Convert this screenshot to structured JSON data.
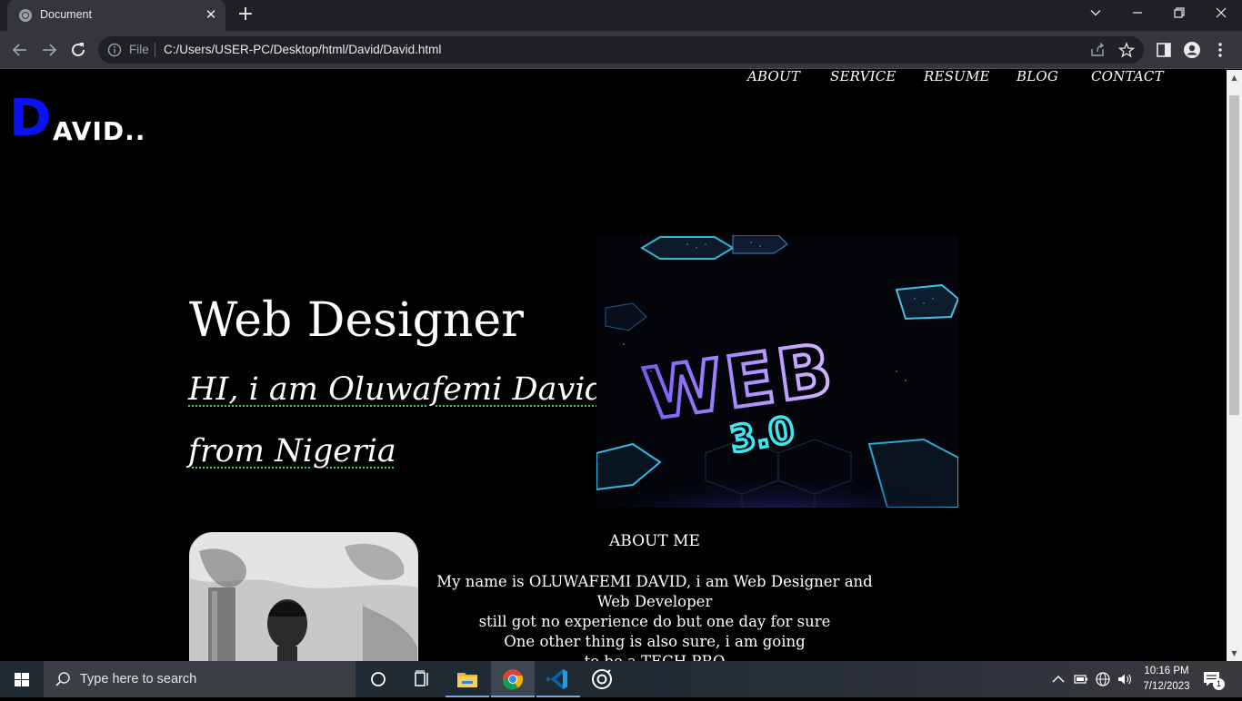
{
  "browser": {
    "tab_title": "Document",
    "tab_close": "✕",
    "new_tab": "+",
    "address_scheme": "File",
    "address_url": "C:/Users/USER-PC/Desktop/html/David/David.html"
  },
  "site": {
    "nav": [
      "ABOUT",
      "SERVICE",
      "RESUME",
      "BLOG",
      "CONTACT"
    ],
    "logo_initial": "D",
    "logo_rest": "AVID..",
    "hero_title": "Web Designer",
    "hero_line1": "HI, i am Oluwafemi David",
    "hero_line2": "from Nigeria",
    "about_heading": "ABOUT ME",
    "about_lines": [
      "My name is OLUWAFEMI DAVID, i am Web Designer and",
      "Web Developer",
      "still got no experience do but one day for sure",
      "One other thing is also sure, i am going",
      "to be a TECH PRO"
    ],
    "image_text_main": "WEB",
    "image_text_sub": "3.0"
  },
  "taskbar": {
    "search_placeholder": "Type here to search",
    "time": "10:16 PM",
    "date": "7/12/2023",
    "notification_count": "1"
  },
  "colors": {
    "logo_accent": "#0a12f5",
    "page_bg": "#000000",
    "underline": "#3bd16f"
  }
}
